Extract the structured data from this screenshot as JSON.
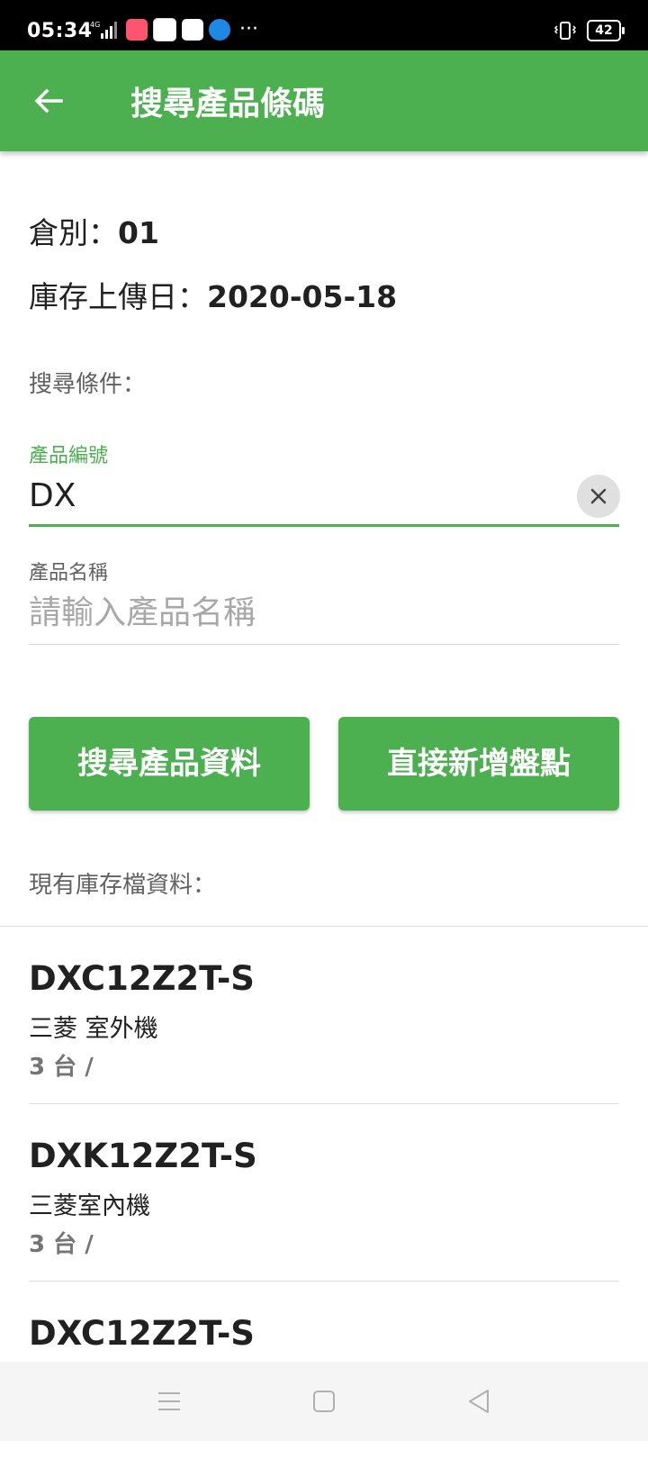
{
  "status": {
    "time": "05:34",
    "battery": "42"
  },
  "appbar": {
    "title": "搜尋產品條碼"
  },
  "info": {
    "warehouse_label": "倉別：",
    "warehouse_value": "01",
    "upload_label": "庫存上傳日：",
    "upload_value": "2020-05-18"
  },
  "search": {
    "section_label": "搜尋條件：",
    "product_no_label": "產品編號",
    "product_no_value": "DX",
    "product_name_label": "產品名稱",
    "product_name_placeholder": "請輸入產品名稱"
  },
  "buttons": {
    "search": "搜尋產品資料",
    "add": "直接新增盤點"
  },
  "list": {
    "section_label": "現有庫存檔資料：",
    "items": [
      {
        "code": "DXC12Z2T-S",
        "name": "三菱 室外機",
        "qty": "3 台 /"
      },
      {
        "code": "DXK12Z2T-S",
        "name": "三菱室內機",
        "qty": "3 台 /"
      },
      {
        "code": "DXC12Z2T-S",
        "name": "",
        "qty": ""
      }
    ]
  },
  "colors": {
    "primary": "#4caf50",
    "status_bar": "#000000",
    "nav_bar": "#f5f5f5"
  }
}
